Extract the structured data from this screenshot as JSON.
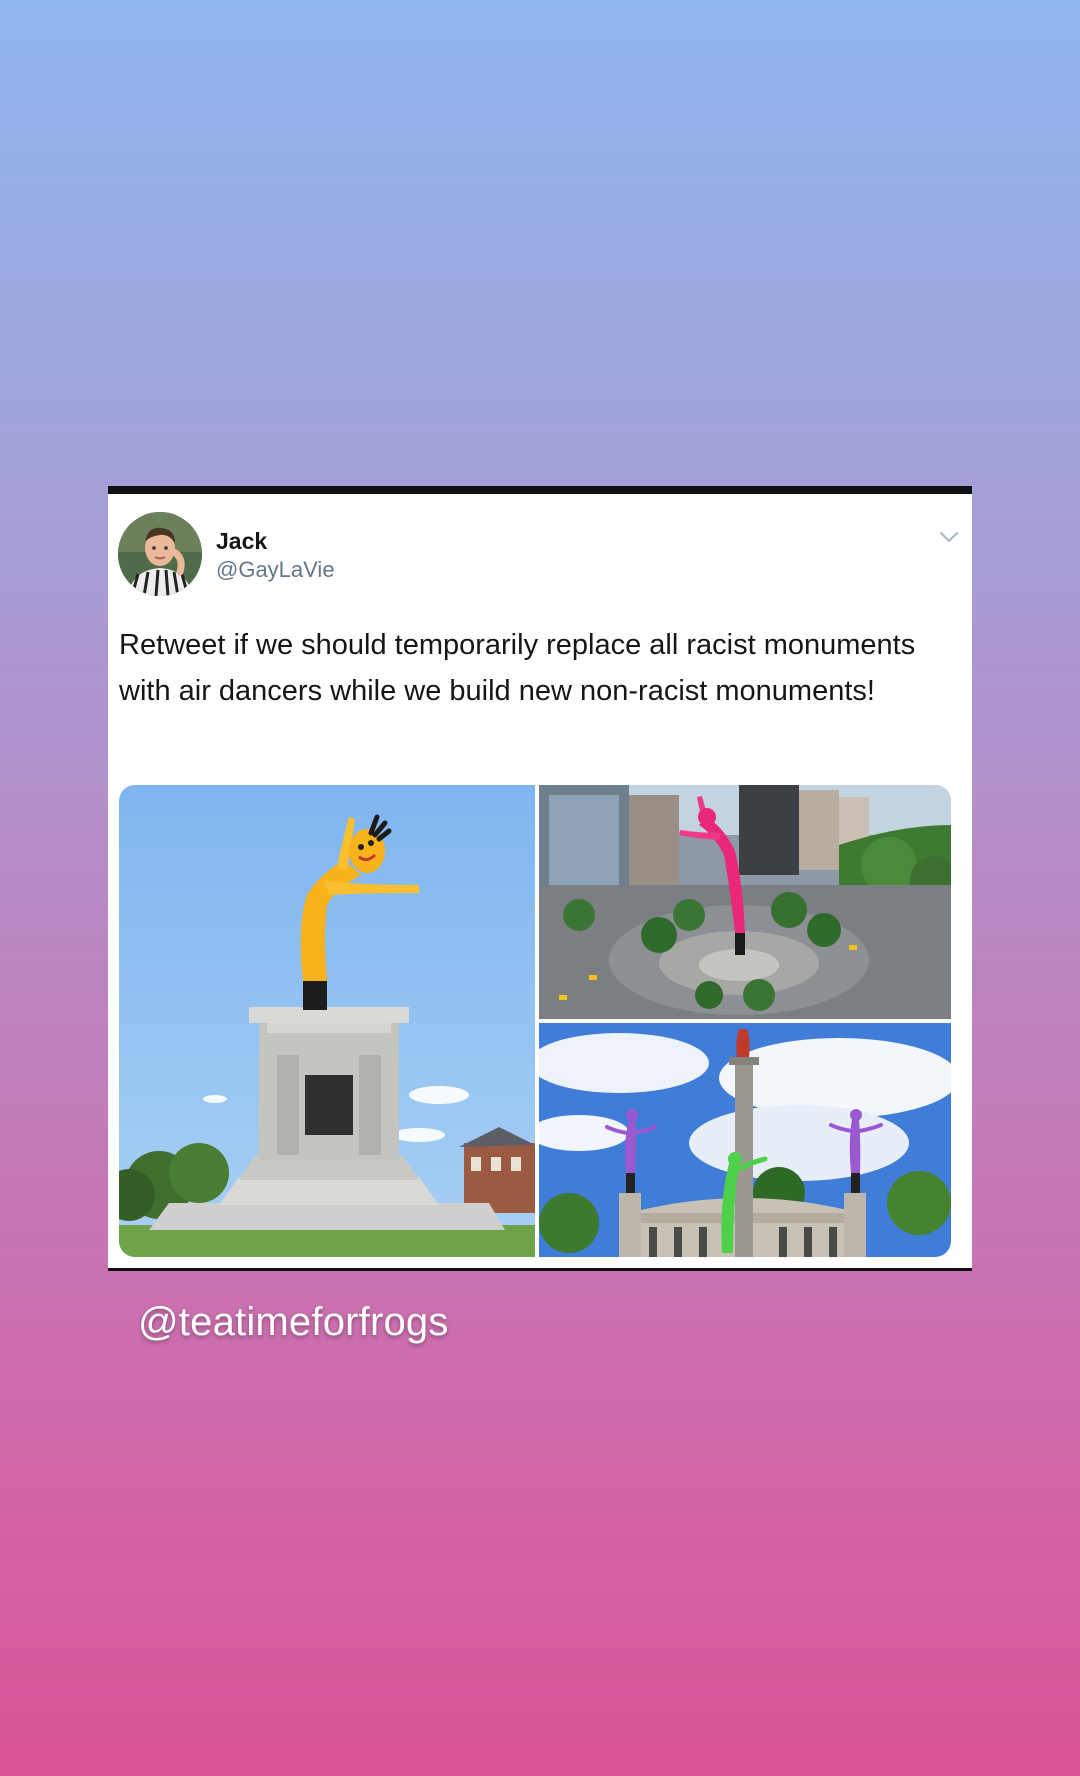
{
  "tweet": {
    "display_name": "Jack",
    "handle": "@GayLaVie",
    "text": "Retweet if we should temporarily replace all racist monuments with air dancers while we build new non-racist monuments!",
    "menu_icon": "chevron-down-icon",
    "media": [
      {
        "subject": "yellow air dancer on monument"
      },
      {
        "subject": "pink air dancer on circle monument"
      },
      {
        "subject": "purple and green air dancers on columns"
      }
    ]
  },
  "story": {
    "mention": "@teatimeforfrogs"
  },
  "colors": {
    "card_border": "#111111",
    "name": "#14171a",
    "handle": "#657786",
    "gradient_top": "#8fb5ed",
    "gradient_bottom": "#d95398"
  }
}
